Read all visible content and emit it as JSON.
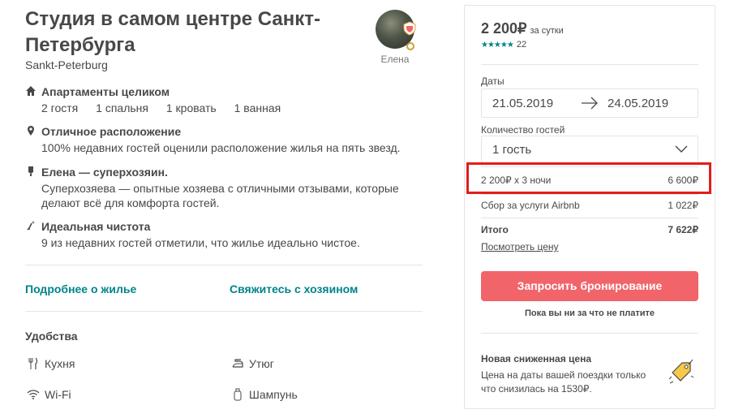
{
  "listing": {
    "title": "Студия в самом центре Санкт-Петербурга",
    "location": "Sankt-Peterburg",
    "host_name": "Елена"
  },
  "features": [
    {
      "icon": "home-icon",
      "title": "Апартаменты целиком",
      "details": [
        "2 гостя",
        "1 спальня",
        "1 кровать",
        "1 ванная"
      ]
    },
    {
      "icon": "location-pin-icon",
      "title": "Отличное расположение",
      "desc": "100% недавних гостей оценили расположение жилья на пять звезд."
    },
    {
      "icon": "superhost-medal-icon",
      "title": "Елена — суперхозяин.",
      "desc": "Суперхозяева — опытные хозяева с отличными отзывами, которые делают всё для комфорта гостей."
    },
    {
      "icon": "sparkle-broom-icon",
      "title": "Идеальная чистота",
      "desc": "9 из недавних гостей отметили, что жилье идеально чистое."
    }
  ],
  "links": {
    "more_about": "Подробнее о жилье",
    "contact_host": "Свяжитесь с хозяином"
  },
  "amenities": {
    "title": "Удобства",
    "items": [
      {
        "icon": "fork-knife-icon",
        "label": "Кухня"
      },
      {
        "icon": "iron-icon",
        "label": "Утюг"
      },
      {
        "icon": "wifi-icon",
        "label": "Wi-Fi"
      },
      {
        "icon": "shampoo-bottle-icon",
        "label": "Шампунь"
      }
    ]
  },
  "booking": {
    "price": "2 200₽",
    "per_night": "за сутки",
    "stars": "★★★★★",
    "review_count": "22",
    "dates_label": "Даты",
    "check_in": "21.05.2019",
    "check_out": "24.05.2019",
    "guests_label": "Количество гостей",
    "guests_value": "1 гость",
    "nights_line": "2 200₽ x 3 ночи",
    "nights_total": "6 600₽",
    "fee_label": "Сбор за услуги Airbnb",
    "fee_value": "1 022₽",
    "total_label": "Итого",
    "total_value": "7 622₽",
    "see_price": "Посмотреть цену",
    "book_button": "Запросить бронирование",
    "no_charge": "Пока вы ни за что не платите",
    "deal_title": "Новая сниженная цена",
    "deal_text": "Цена на даты вашей поездки только что снизилась на 1530₽.",
    "accent_color": "#f1646a",
    "link_color": "#008489",
    "highlight_color": "#e31c1c"
  }
}
